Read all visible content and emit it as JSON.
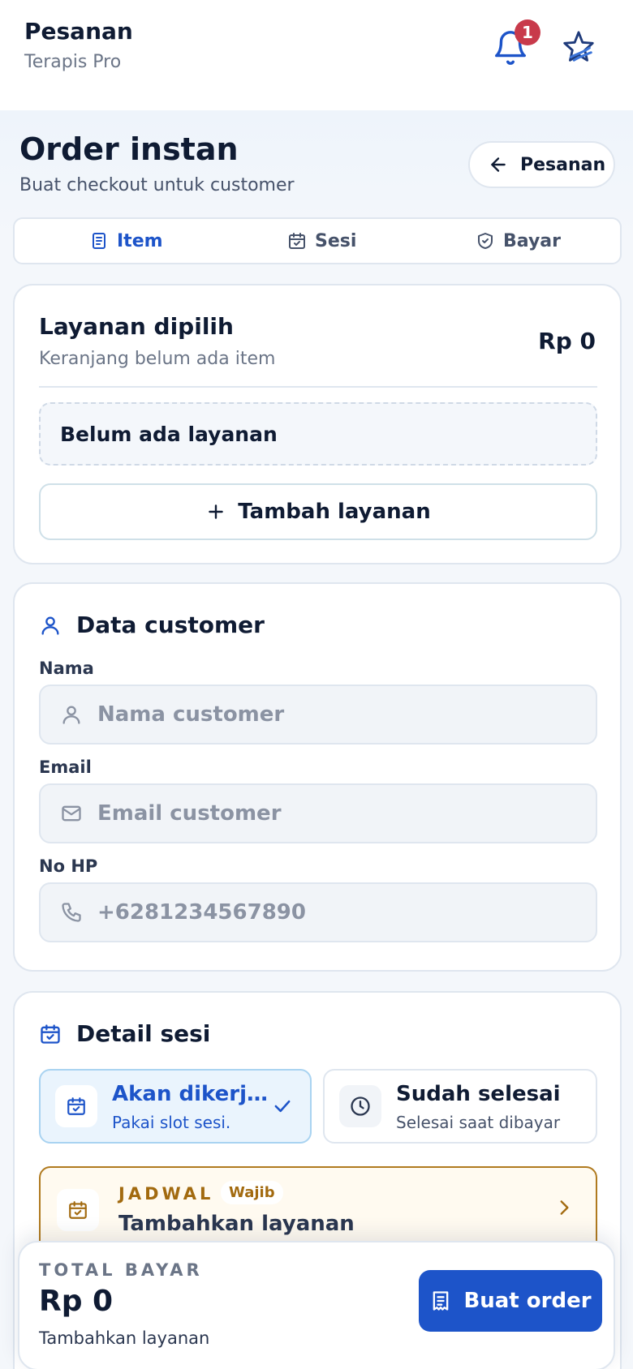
{
  "appbar": {
    "title": "Pesanan",
    "subtitle": "Terapis Pro",
    "notification_count": "1"
  },
  "header": {
    "title": "Order instan",
    "subtitle": "Buat checkout untuk customer",
    "back_label": "Pesanan"
  },
  "steps": [
    {
      "label": "Item",
      "icon": "clipboard-list-icon",
      "active": true
    },
    {
      "label": "Sesi",
      "icon": "calendar-check-icon",
      "active": false
    },
    {
      "label": "Bayar",
      "icon": "shield-check-icon",
      "active": false
    }
  ],
  "services": {
    "title": "Layanan dipilih",
    "subtitle": "Keranjang belum ada item",
    "total": "Rp 0",
    "empty_text": "Belum ada layanan",
    "add_label": "Tambah layanan"
  },
  "customer": {
    "title": "Data customer",
    "fields": [
      {
        "label": "Nama",
        "placeholder": "Nama customer",
        "icon": "user-icon"
      },
      {
        "label": "Email",
        "placeholder": "Email customer",
        "icon": "mail-icon"
      },
      {
        "label": "No HP",
        "placeholder": "+6281234567890",
        "icon": "phone-icon"
      }
    ]
  },
  "session": {
    "title": "Detail sesi",
    "options": [
      {
        "title": "Akan dikerj…",
        "subtitle": "Pakai slot sesi.",
        "selected": true
      },
      {
        "title": "Sudah selesai",
        "subtitle": "Selesai saat dibayar",
        "selected": false
      }
    ],
    "schedule": {
      "tag": "JADWAL",
      "required": "Wajib",
      "text": "Tambahkan layanan"
    }
  },
  "footer": {
    "total_label": "TOTAL BAYAR",
    "total_value": "Rp 0",
    "hint": "Tambahkan layanan",
    "order_label": "Buat order"
  },
  "colors": {
    "primary": "#1d54c9",
    "badge": "#c83a4b",
    "warning": "#a26a0f",
    "text": "#0f1b33"
  }
}
